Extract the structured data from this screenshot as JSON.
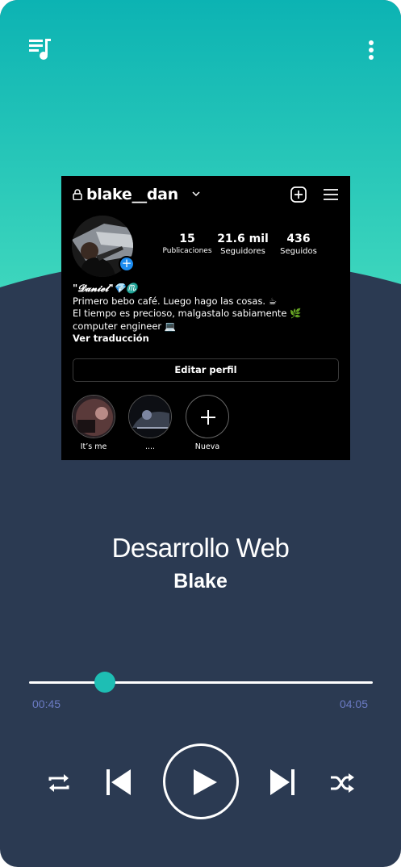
{
  "colors": {
    "accent": "#1ebeb4",
    "background": "#2b3a52",
    "time_text": "#6b7bc4"
  },
  "top_bar": {
    "left_icon": "playlist-icon",
    "right_icon": "more-vertical-icon"
  },
  "instagram_card": {
    "username": "blake__dan",
    "stats": [
      {
        "value": "15",
        "label": "Publicaciones"
      },
      {
        "value": "21.6 mil",
        "label": "Seguidores"
      },
      {
        "value": "436",
        "label": "Seguidos"
      }
    ],
    "bio": {
      "name": "\"𝓓𝓪𝓷𝓲𝓮𝓵\"💎♏",
      "line1": "Primero bebo café. Luego hago las cosas. ☕",
      "line2": "El tiempo es precioso, malgastalo sabiamente 🌿computer engineer 💻",
      "translate": "Ver traducción"
    },
    "edit_button": "Editar perfil",
    "highlights": [
      {
        "label": "It’s me"
      },
      {
        "label": "...."
      },
      {
        "label": "Nueva"
      }
    ]
  },
  "track": {
    "title": "Desarrollo Web",
    "artist": "Blake",
    "current_time": "00:45",
    "total_time": "04:05",
    "progress": 0.22
  },
  "controls": [
    "repeat-icon",
    "previous-icon",
    "play-icon",
    "next-icon",
    "shuffle-icon"
  ]
}
